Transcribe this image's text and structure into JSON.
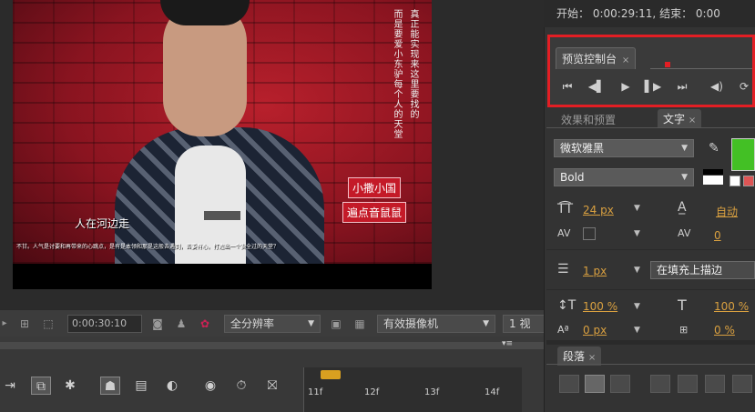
{
  "viewer": {
    "overlay_vertical_text_right": "真正能实现来这里要找的",
    "overlay_vertical_text_left": "而是要爱小东驴每个人的天堂",
    "badge_top": "小撒小国",
    "badge_bottom": "遍点音鼠鼠",
    "subtitle": "人在河边走",
    "subtitle_small": "不甘。人气是讨要和再带来的心跳点，是有是本领和那是这般去遇到，去要有心。打造出一个安全过的天堂？"
  },
  "viewer_toolbar": {
    "timecode": "0:00:30:10",
    "resolution": "全分辨率",
    "camera": "有效摄像机",
    "views": "1 视",
    "icons": [
      "region-icon",
      "transparency-grid-icon",
      "camera-snapshot-icon",
      "show-snapshot-icon",
      "color-channels-icon",
      "fast-preview-icon",
      "grid-toggle-icon"
    ]
  },
  "timeline": {
    "ruler_ticks": [
      "11f",
      "12f",
      "13f",
      "14f"
    ],
    "tool_icons": [
      "keyframe-nav-icon",
      "composition-nesting-icon",
      "draft-3d-icon",
      "hide-shy-icon",
      "frame-blending-icon",
      "motion-blur-icon",
      "graph-editor-icon",
      "stopwatch-icon",
      "comp-flowchart-icon"
    ]
  },
  "info_bar": {
    "start_label": "开始：",
    "start_value": "0:00:29:11",
    "end_label": "结束：",
    "end_value": "0:00"
  },
  "preview_panel": {
    "tab_label": "预览控制台",
    "controls": [
      "first-frame-icon",
      "previous-frame-icon",
      "play-icon",
      "next-frame-icon",
      "last-frame-icon",
      "audio-icon",
      "loop-icon"
    ]
  },
  "character_panel": {
    "tab_effects": "效果和预置",
    "tab_text": "文字",
    "font_family": "微软雅黑",
    "font_style": "Bold",
    "font_size": "24 px",
    "leading": "自动",
    "kerning": "0",
    "stroke_width": "1 px",
    "stroke_mode": "在填充上描边",
    "vertical_scale": "100 %",
    "horizontal_scale": "100 %",
    "baseline_shift": "0 px",
    "tsume": "0 %",
    "fill_color": "#43c025"
  },
  "paragraph_panel": {
    "tab_label": "段落"
  }
}
